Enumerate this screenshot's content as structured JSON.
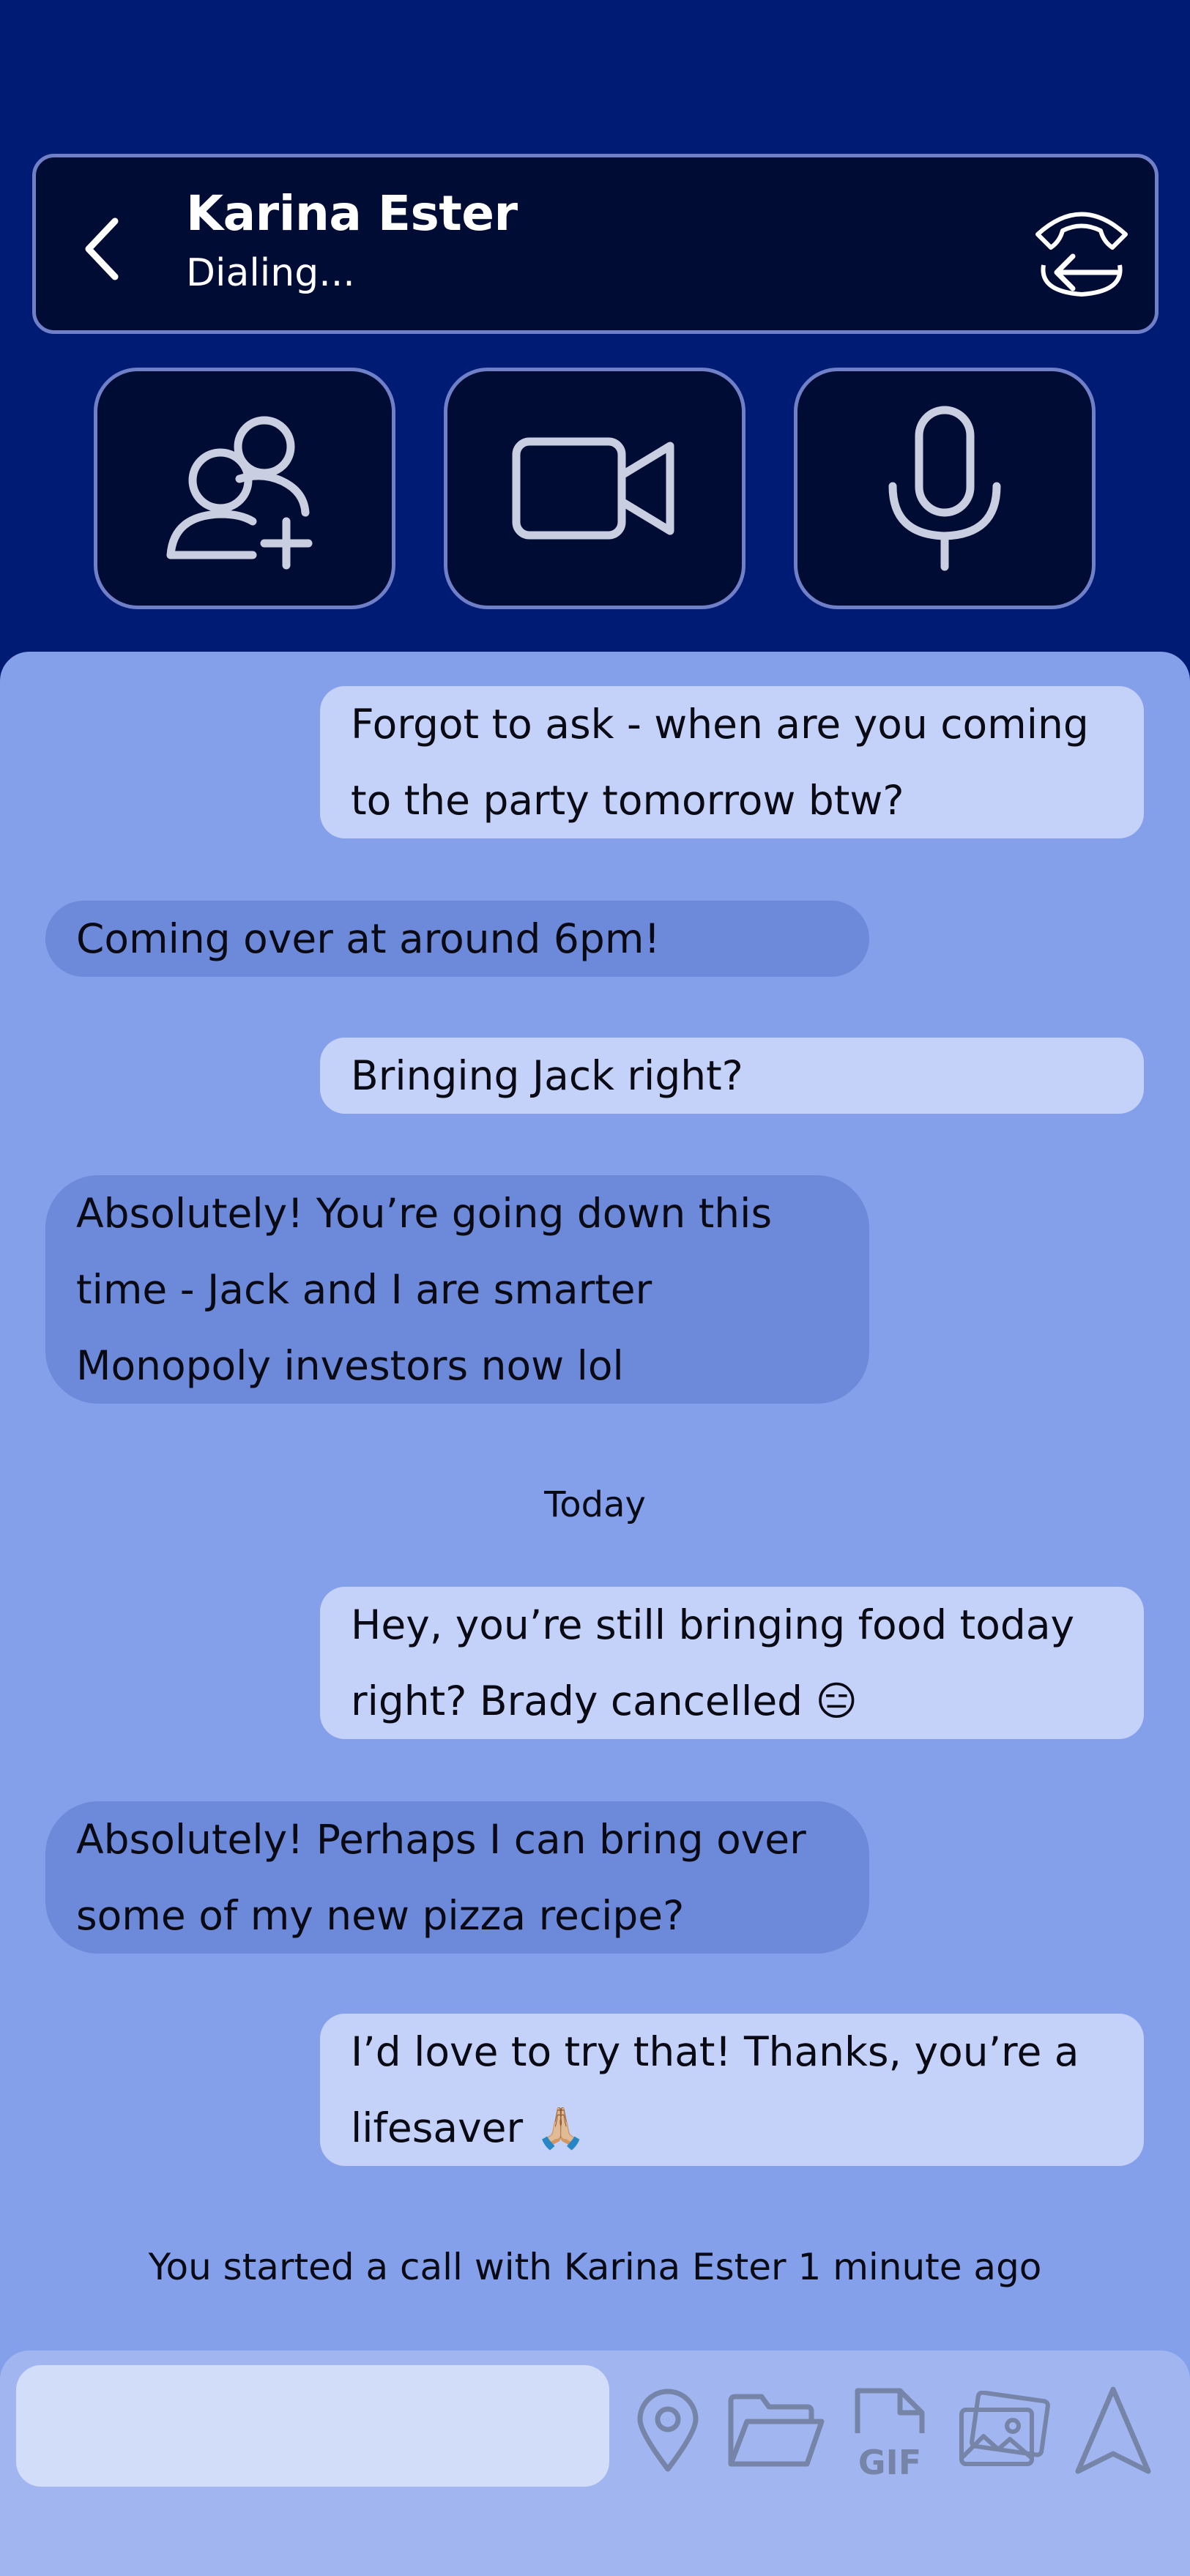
{
  "header": {
    "contact_name": "Karina Ester",
    "call_status": "Dialing..."
  },
  "actions": [
    {
      "icon": "add-user-icon"
    },
    {
      "icon": "video-camera-icon"
    },
    {
      "icon": "microphone-icon"
    }
  ],
  "messages": [
    {
      "direction": "sent",
      "lines": [
        "Forgot to ask - when are you coming",
        "to the party tomorrow btw?"
      ]
    },
    {
      "direction": "received",
      "lines": [
        "Coming over at around 6pm!"
      ]
    },
    {
      "direction": "sent",
      "lines": [
        "Bringing Jack right?"
      ]
    },
    {
      "direction": "received",
      "lines": [
        "Absolutely! You’re going down this",
        "time - Jack and I are smarter",
        "Monopoly investors now lol"
      ]
    },
    {
      "direction": "sent",
      "lines": [
        "Hey, you’re still bringing food today",
        "right? Brady cancelled 😑"
      ]
    },
    {
      "direction": "received",
      "lines": [
        "Absolutely! Perhaps I can bring over",
        "some of my new pizza recipe?"
      ]
    },
    {
      "direction": "sent",
      "lines": [
        "I’d love to try that! Thanks, you’re a",
        "lifesaver 🙏🏼"
      ]
    }
  ],
  "date_divider": "Today",
  "call_notice": "You started a call with Karina Ester 1 minute ago",
  "composer": {
    "placeholder": "",
    "tools": [
      "location-icon",
      "folder-icon",
      "gif-icon",
      "images-icon",
      "send-icon"
    ]
  },
  "colors": {
    "background": "#001b74",
    "header_bg": "#000c34",
    "chat_bg": "#84a0ea",
    "sent_bubble": "#c4d1f9",
    "received_bubble": "#6d89da"
  }
}
